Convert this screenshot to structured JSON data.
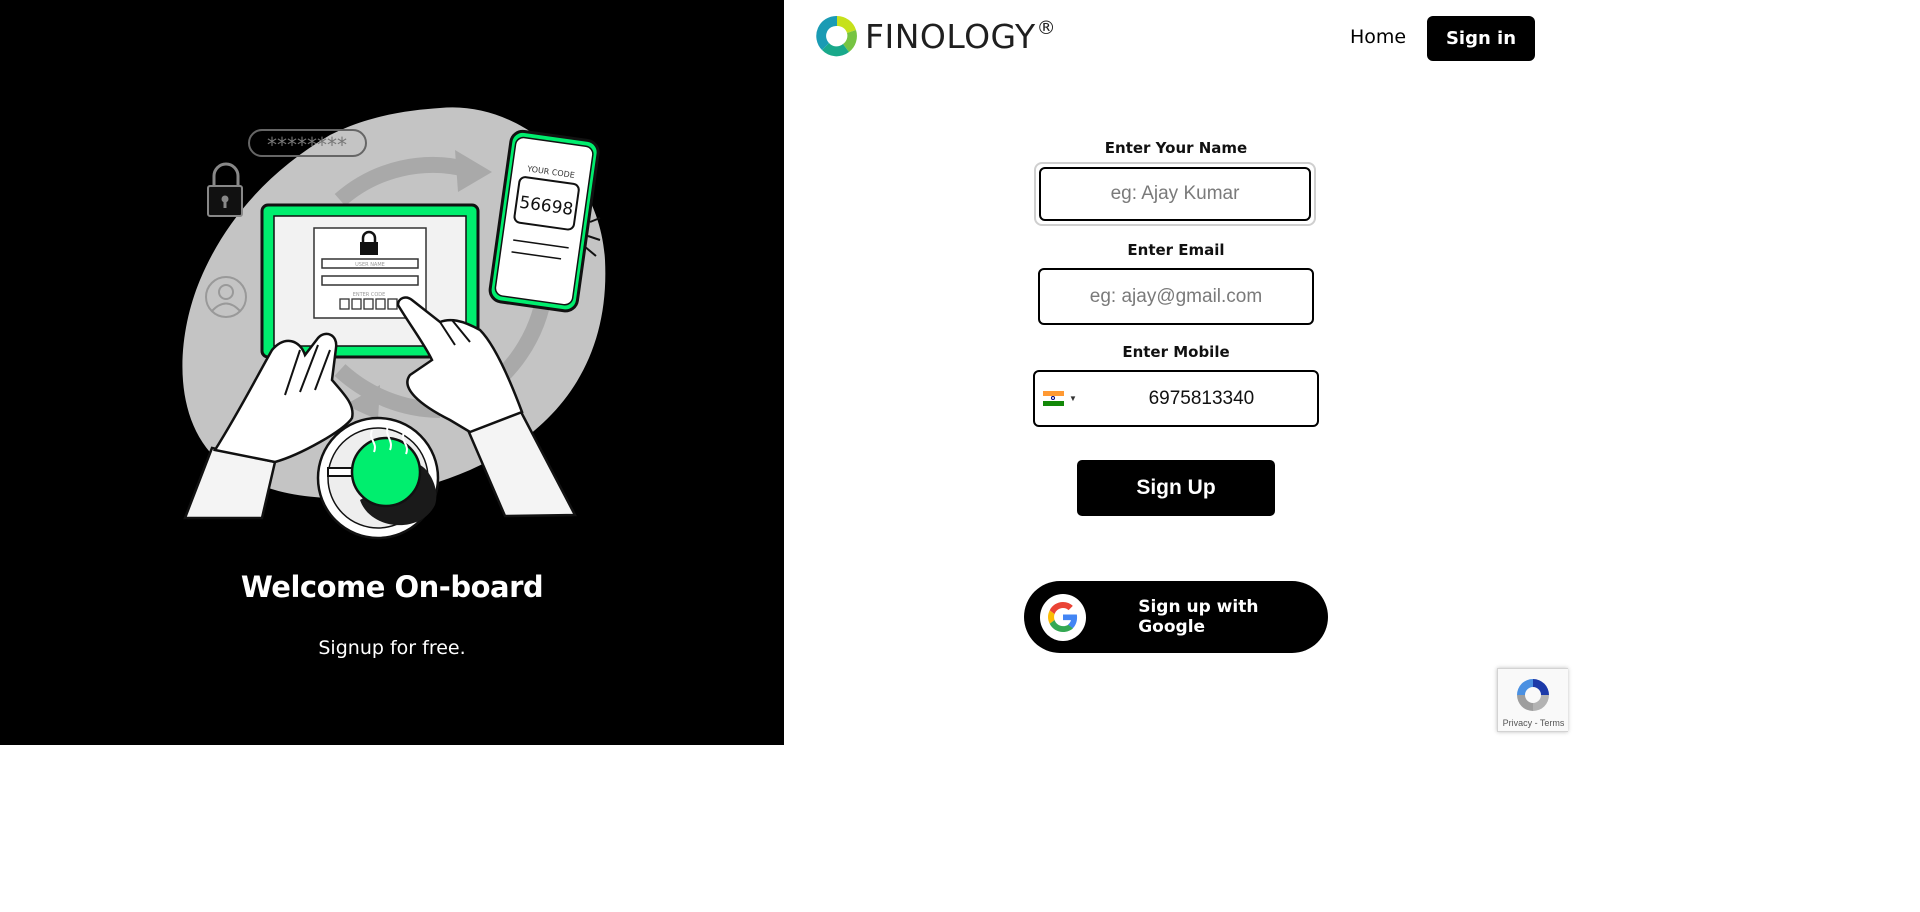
{
  "left": {
    "welcome_title": "Welcome On-board",
    "welcome_subtitle": "Signup for free.",
    "illustration": {
      "password_mask": "********",
      "phone_code_label": "YOUR CODE",
      "phone_code": "56698",
      "tablet_username_label": "USER NAME",
      "tablet_code_label": "ENTER CODE",
      "accent_color": "#00ee6e"
    }
  },
  "header": {
    "brand": "FINOLOGY",
    "brand_mark": "®",
    "nav_home": "Home",
    "nav_signin": "Sign in"
  },
  "form": {
    "name_label": "Enter Your Name",
    "name_placeholder": "eg: Ajay Kumar",
    "email_label": "Enter Email",
    "email_placeholder": "eg: ajay@gmail.com",
    "mobile_label": "Enter Mobile",
    "mobile_value": "6975813340",
    "country_flag": "india-flag-icon",
    "signup_label": "Sign Up",
    "google_label": "Sign up with Google"
  },
  "recaptcha": {
    "links": "Privacy - Terms"
  },
  "colors": {
    "left_bg": "#000000",
    "accent_green": "#00ee6e",
    "button_bg": "#000000"
  }
}
